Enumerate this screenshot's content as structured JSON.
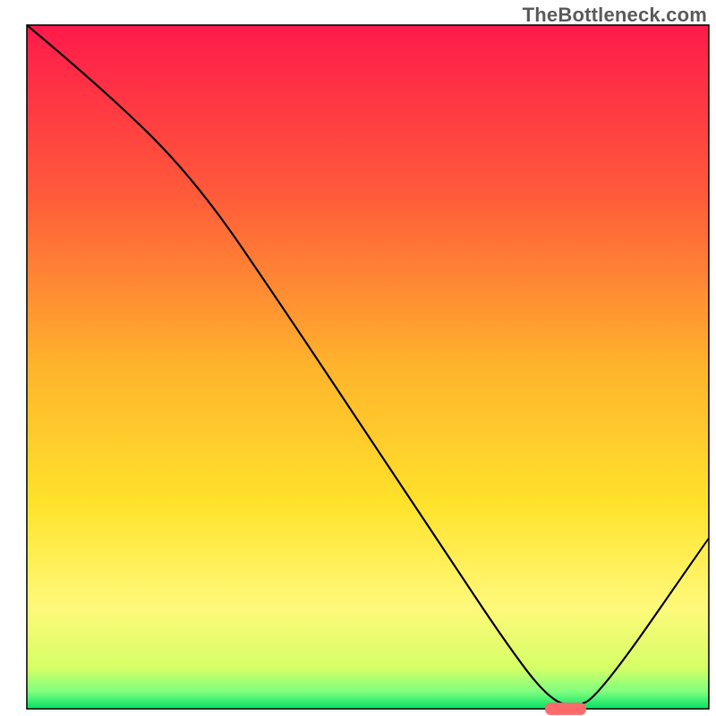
{
  "watermark": "TheBottleneck.com",
  "chart_data": {
    "type": "line",
    "title": "",
    "xlabel": "",
    "ylabel": "",
    "xlim": [
      0,
      100
    ],
    "ylim": [
      0,
      100
    ],
    "grid": false,
    "legend": false,
    "background_gradient": {
      "stops": [
        {
          "offset": 0.0,
          "color": "#ff1a4b"
        },
        {
          "offset": 0.25,
          "color": "#ff5b3a"
        },
        {
          "offset": 0.5,
          "color": "#ffb42c"
        },
        {
          "offset": 0.7,
          "color": "#ffe22b"
        },
        {
          "offset": 0.85,
          "color": "#fff97a"
        },
        {
          "offset": 0.94,
          "color": "#d6ff66"
        },
        {
          "offset": 0.975,
          "color": "#7fff7f"
        },
        {
          "offset": 1.0,
          "color": "#00e065"
        }
      ]
    },
    "series": [
      {
        "name": "bottleneck-curve",
        "color": "#000000",
        "x": [
          0,
          12,
          25,
          38,
          50,
          62,
          70,
          76,
          80,
          84,
          100
        ],
        "y": [
          100,
          90,
          77,
          58,
          40,
          22,
          10,
          2,
          0,
          2,
          25
        ]
      }
    ],
    "marker": {
      "name": "optimal-point",
      "x": 79,
      "y": 0,
      "color": "#ff6a6a",
      "width": 6,
      "height": 1.8
    }
  }
}
